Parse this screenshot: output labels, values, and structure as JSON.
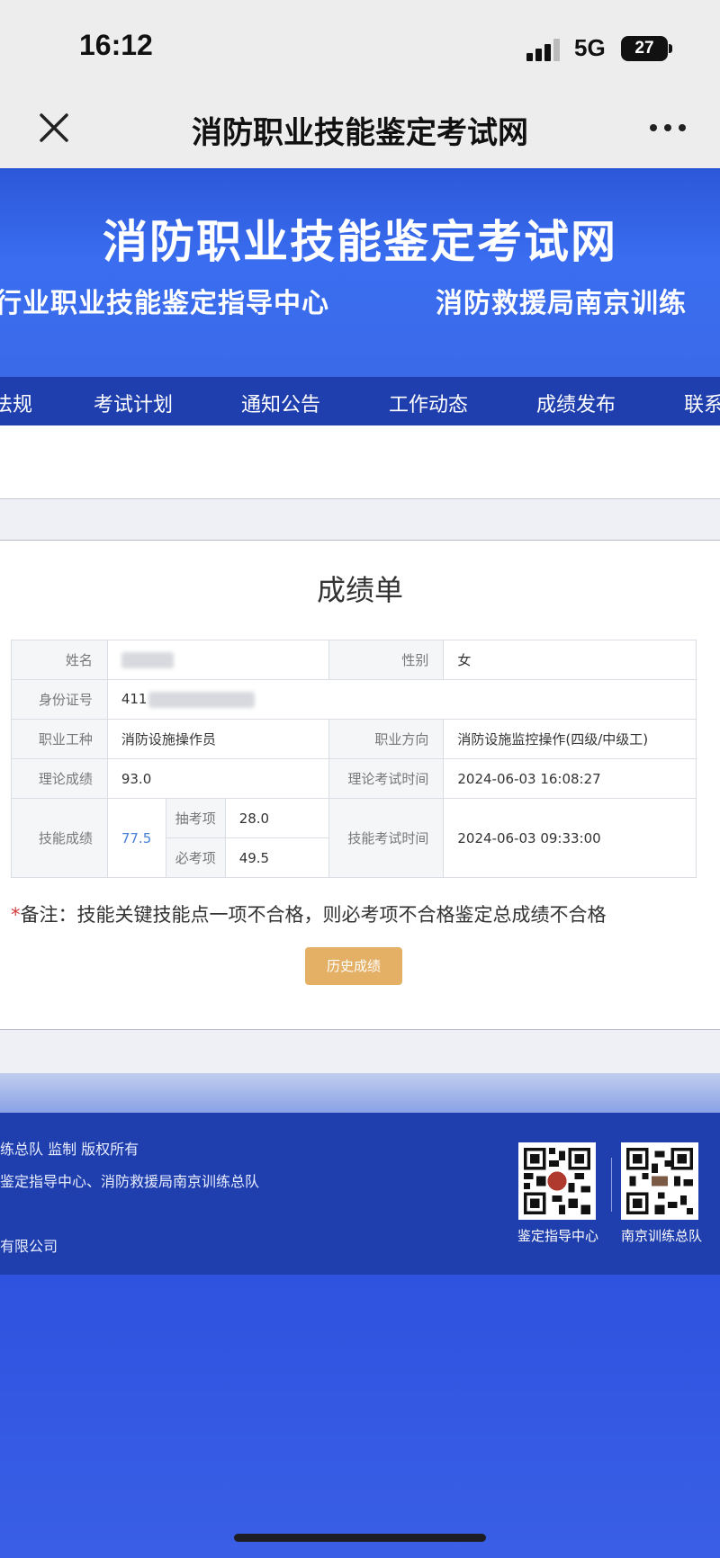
{
  "status_bar": {
    "time": "16:12",
    "network": "5G",
    "battery": "27"
  },
  "title_bar": {
    "title": "消防职业技能鉴定考试网"
  },
  "banner": {
    "title": "消防职业技能鉴定考试网",
    "subtitle_left": "行业职业技能鉴定指导中心",
    "subtitle_right": "消防救援局南京训练"
  },
  "nav": {
    "items": [
      "法规",
      "考试计划",
      "通知公告",
      "工作动态",
      "成绩发布",
      "联系"
    ]
  },
  "report": {
    "title": "成绩单",
    "labels": {
      "name": "姓名",
      "gender": "性别",
      "id": "身份证号",
      "job_type": "职业工种",
      "job_direction": "职业方向",
      "theory_score": "理论成绩",
      "theory_time": "理论考试时间",
      "skill_score": "技能成绩",
      "skill_time": "技能考试时间",
      "sampled": "抽考项",
      "required": "必考项"
    },
    "values": {
      "name": "",
      "gender": "女",
      "id": "411",
      "job_type": "消防设施操作员",
      "job_direction": "消防设施监控操作(四级/中级工)",
      "theory_score": "93.0",
      "theory_time": "2024-06-03 16:08:27",
      "skill_score": "77.5",
      "sampled_score": "28.0",
      "required_score": "49.5",
      "skill_time": "2024-06-03 09:33:00"
    },
    "note_star": "*",
    "note": "备注：技能关键技能点一项不合格，则必考项不合格鉴定总成绩不合格",
    "history_button": "历史成绩"
  },
  "footer": {
    "line1": "练总队 监制 版权所有",
    "line2": "鉴定指导中心、消防救援局南京训练总队",
    "line3": "有限公司",
    "qr1_label": "鉴定指导中心",
    "qr2_label": "南京训练总队"
  },
  "colors": {
    "nav_bg": "#1f3fae",
    "banner_bg": "#3a6df0",
    "button": "#e4b065",
    "skill_value": "#4a7fd6",
    "note_star": "#d23a3a"
  }
}
